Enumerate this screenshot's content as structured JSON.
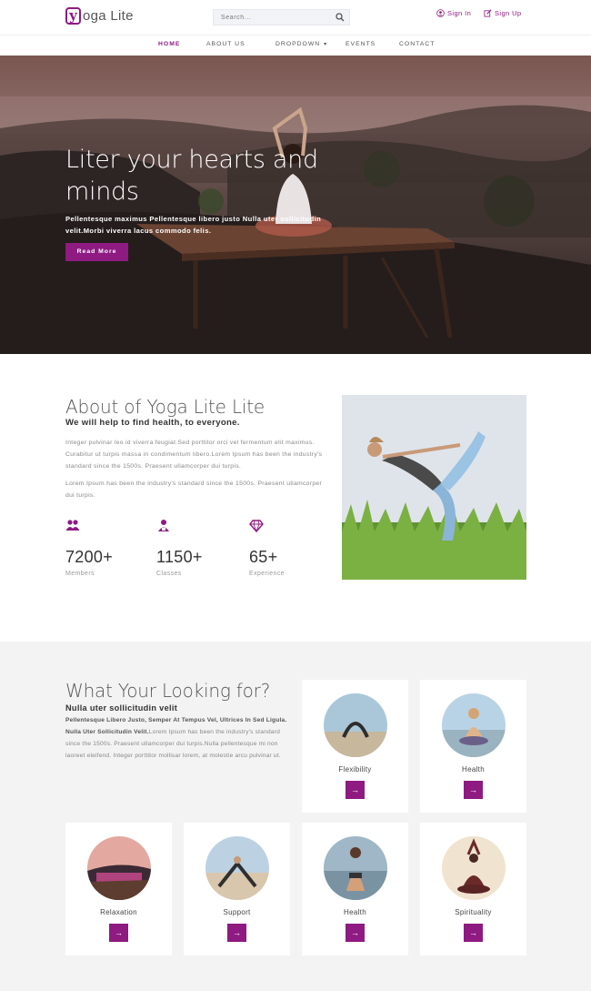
{
  "header": {
    "logo_letter": "y",
    "logo_text": "oga Lite",
    "search_placeholder": "Search...",
    "sign_in": "Sign In",
    "sign_up": "Sign Up"
  },
  "nav": {
    "items": [
      {
        "label": "HOME",
        "active": true
      },
      {
        "label": "ABOUT US"
      },
      {
        "label": "DROPDOWN",
        "has_caret": true
      },
      {
        "label": "EVENTS"
      },
      {
        "label": "CONTACT"
      }
    ]
  },
  "hero": {
    "title": "Liter your hearts and minds",
    "text": "Pellentesque maximus Pellentesque libero justo Nulla uter sollicitudin velit.Morbi viverra lacus commodo felis.",
    "button": "Read More"
  },
  "about": {
    "title": "About of Yoga Lite Lite",
    "subtitle": "We will help to find health, to everyone.",
    "para1": "Integer pulvinar leo id viverra feugiat.Sed porttitor orci vel fermentum elit maximus. Curabitur ut turpis massa in condimentum libero.Lorem Ipsum has been the industry's standard since the 1500s. Praesent ullamcorper dui turpis.",
    "para2": "Lorem Ipsum has been the industry's standard since the 1500s. Praesent ullamcorper dui turpis.",
    "stats": [
      {
        "icon": "members-icon",
        "value": "7200+",
        "label": "Members"
      },
      {
        "icon": "classes-icon",
        "value": "1150+",
        "label": "Classes"
      },
      {
        "icon": "diamond-icon",
        "value": "65+",
        "label": "Experience"
      }
    ]
  },
  "services": {
    "title": "What Your Looking for?",
    "subtitle": "Nulla uter sollicitudin velit",
    "bold_text": "Pellentesque Libero Justo, Semper At Tempus Vel, Ultrices In Sed Ligula. Nulla Uter Sollicitudin Velit.",
    "text": "Lorem Ipsum has been the industry's standard since the 1500s. Praesent ullamcorper dui turpis.Nulla pellentesque mi non laoreet eleifend. Integer porttitor mollisar lorem, at molestie arcu pulvinar ut.",
    "cards": [
      {
        "label": "Flexibility",
        "button": "→"
      },
      {
        "label": "Health",
        "button": "→"
      },
      {
        "label": "Relaxation",
        "button": "→"
      },
      {
        "label": "Support",
        "button": "→"
      },
      {
        "label": "Health",
        "button": "→"
      },
      {
        "label": "Spirituality",
        "button": "→"
      }
    ]
  },
  "colors": {
    "brand": "#8e1a82",
    "background_alt": "#f3f3f4"
  }
}
